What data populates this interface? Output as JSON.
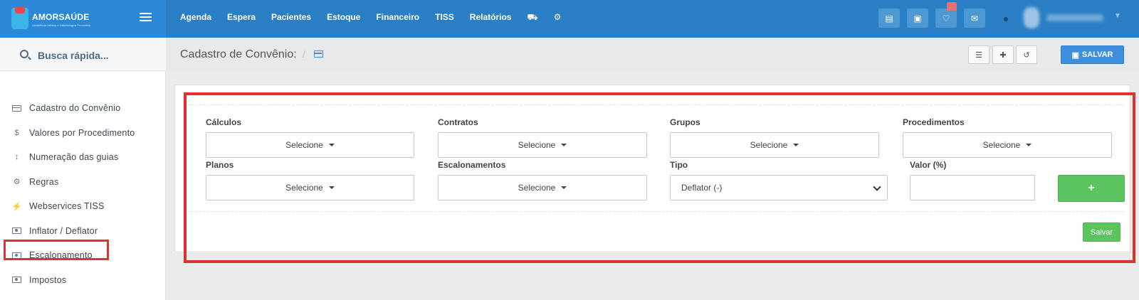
{
  "brand": {
    "name": "AMORSAÚDE",
    "subtitle": "Assistência Médica e Odontológica Preventiva"
  },
  "topnav": {
    "items": [
      "Agenda",
      "Espera",
      "Pacientes",
      "Estoque",
      "Financeiro",
      "TISS",
      "Relatórios"
    ],
    "extra_icons": [
      "database-icon",
      "gear-icon"
    ]
  },
  "top_right_icons": [
    "inbox-icon",
    "id-card-icon",
    "bell-icon",
    "chat-icon"
  ],
  "search": {
    "placeholder": "Busca rápida..."
  },
  "sidebar": {
    "items": [
      {
        "label": "Cadastro do Convênio",
        "icon": "credit-card-icon"
      },
      {
        "label": "Valores por Procedimento",
        "icon": "dollar-icon"
      },
      {
        "label": "Numeração das guias",
        "icon": "sort-numeric-icon"
      },
      {
        "label": "Regras",
        "icon": "gears-icon"
      },
      {
        "label": "Webservices TISS",
        "icon": "plug-icon"
      },
      {
        "label": "Inflator / Deflator",
        "icon": "money-icon"
      },
      {
        "label": "Escalonamento",
        "icon": "money-icon"
      },
      {
        "label": "Impostos",
        "icon": "money-icon"
      }
    ]
  },
  "page": {
    "title": "Cadastro de Convênio:",
    "separator": "/",
    "save_label": "SALVAR"
  },
  "form": {
    "calculos_label": "Cálculos",
    "contratos_label": "Contratos",
    "grupos_label": "Grupos",
    "procedimentos_label": "Procedimentos",
    "planos_label": "Planos",
    "escalonamentos_label": "Escalonamentos",
    "tipo_label": "Tipo",
    "valor_label": "Valor (%)",
    "select_placeholder": "Selecione",
    "tipo_value": "Deflator (-)",
    "valor_value": "",
    "add_label": "+",
    "save_label": "Salvar"
  },
  "colors": {
    "topbar": "#2a7fc4",
    "primary": "#3d8fde",
    "success": "#5cc45f",
    "highlight": "#e03131"
  }
}
